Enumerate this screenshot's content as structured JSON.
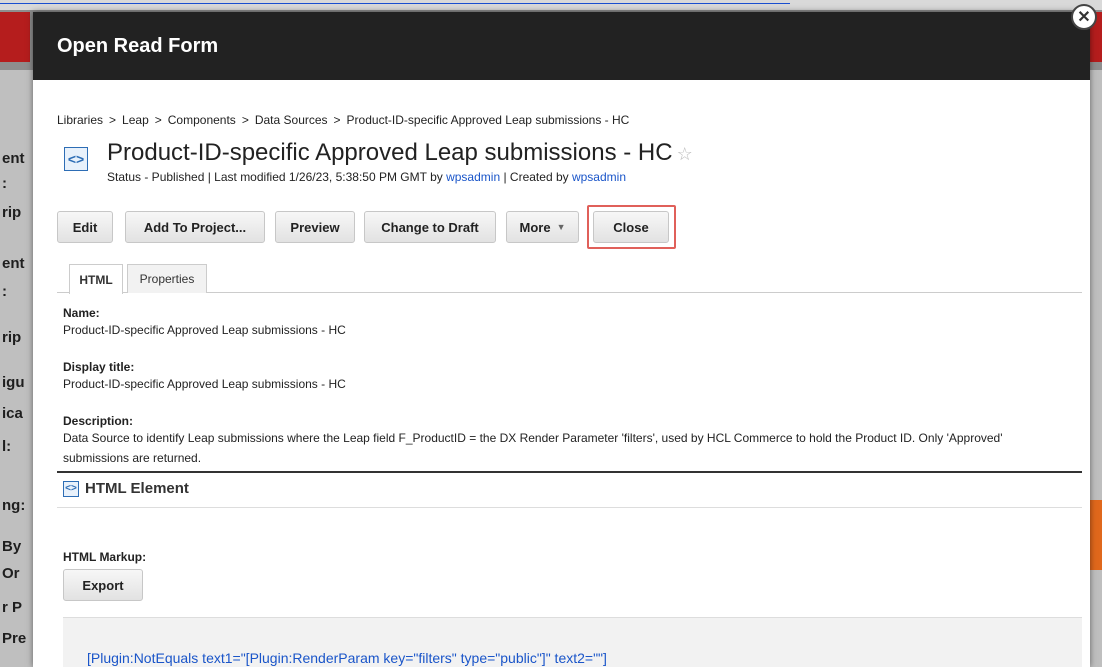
{
  "background": {
    "fragments": [
      "ent",
      ":",
      "rip",
      "ent",
      ":",
      "rip",
      "igu",
      "ica",
      "l:",
      "ng:",
      "By",
      "Or",
      "r P",
      "Pre"
    ]
  },
  "modal": {
    "title": "Open Read Form",
    "close_glyph": "✕"
  },
  "breadcrumb": [
    "Libraries",
    "Leap",
    "Components",
    "Data Sources",
    "Product-ID-specific Approved Leap submissions - HC"
  ],
  "breadcrumb_separator": ">",
  "document": {
    "icon": "code-brackets-icon",
    "title": "Product-ID-specific Approved Leap submissions - HC",
    "favorite_glyph": "☆",
    "status_prefix": "Status - Published | Last modified 1/26/23, 5:38:50 PM GMT by",
    "modified_by": "wpsadmin",
    "created_prefix": "| Created by",
    "created_by": "wpsadmin"
  },
  "toolbar": {
    "edit": "Edit",
    "add_to_project": "Add To Project...",
    "preview": "Preview",
    "change_to_draft": "Change to Draft",
    "more": "More",
    "more_caret": "▼",
    "close": "Close"
  },
  "tabs": [
    "HTML",
    "Properties"
  ],
  "fields": {
    "name_label": "Name:",
    "name_value": "Product-ID-specific Approved Leap submissions - HC",
    "display_title_label": "Display title:",
    "display_title_value": "Product-ID-specific Approved Leap submissions - HC",
    "description_label": "Description:",
    "description_value": "Data Source to identify Leap submissions where the Leap field F_ProductID = the DX Render Parameter 'filters', used by HCL Commerce to hold the Product ID. Only 'Approved' submissions are returned."
  },
  "html_element": {
    "heading": "HTML Element",
    "markup_label": "HTML Markup:",
    "export": "Export",
    "markup_text": "[Plugin:NotEquals text1=\"[Plugin:RenderParam key=\"filters\" type=\"public\"]\" text2=\"\"]"
  },
  "colors": {
    "header_bg": "#222222",
    "link": "#1a55c9",
    "highlight": "#e0605a"
  }
}
